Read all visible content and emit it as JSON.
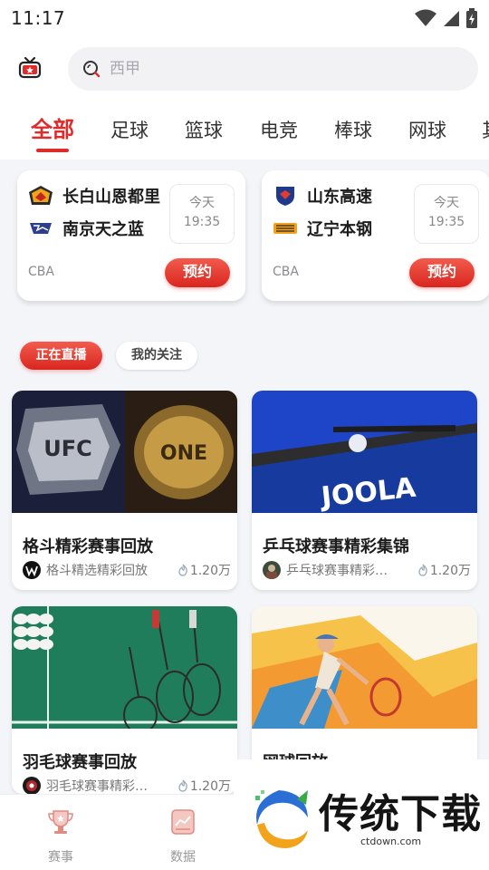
{
  "status_bar": {
    "time": "11:17"
  },
  "search": {
    "placeholder": "西甲"
  },
  "tabs": [
    {
      "label": "全部"
    },
    {
      "label": "足球"
    },
    {
      "label": "篮球"
    },
    {
      "label": "电竞"
    },
    {
      "label": "棒球"
    },
    {
      "label": "网球"
    },
    {
      "label": "其"
    }
  ],
  "matches": [
    {
      "team1": "长白山恩都里",
      "team2": "南京天之蓝",
      "day": "今天",
      "time": "19:35",
      "league": "CBA",
      "button": "预约"
    },
    {
      "team1": "山东高速",
      "team2": "辽宁本钢",
      "day": "今天",
      "time": "19:35",
      "league": "CBA",
      "button": "预约"
    }
  ],
  "filters": {
    "live": "正在直播",
    "follow": "我的关注"
  },
  "videos": [
    {
      "title": "格斗精彩赛事回放",
      "channel": "格斗精选精彩回放",
      "views": "1.20万",
      "thumb_text_1": "UFC",
      "thumb_text_2": "ONE"
    },
    {
      "title": "乒乓球赛事精彩集锦",
      "channel": "乒乓球赛事精彩…",
      "views": "1.20万",
      "thumb_text_1": "JOOLA"
    },
    {
      "title": "羽毛球赛事回放",
      "channel": "羽毛球赛事精彩…",
      "views": "1.20万"
    },
    {
      "title": "网球回放",
      "channel": "",
      "views": ""
    }
  ],
  "bottom_nav": [
    {
      "label": "赛事"
    },
    {
      "label": "数据"
    }
  ],
  "watermark": {
    "text": "传统下载",
    "sub": "ctdown.com"
  },
  "colors": {
    "accent": "#e02b2b",
    "background": "#f4f5f9"
  }
}
